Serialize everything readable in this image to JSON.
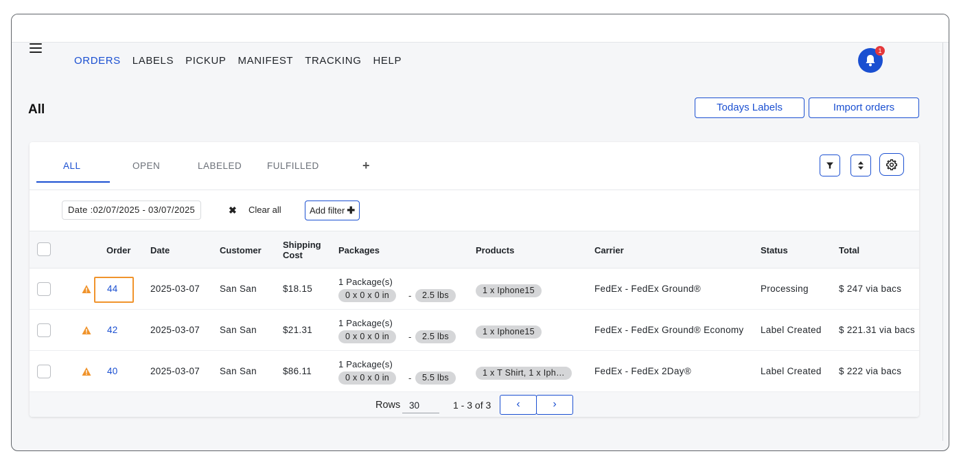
{
  "nav": {
    "items": [
      "ORDERS",
      "LABELS",
      "PICKUP",
      "MANIFEST",
      "TRACKING",
      "HELP"
    ],
    "notification_count": "1"
  },
  "page": {
    "title": "All",
    "todays_labels_label": "Todays Labels",
    "import_orders_label": "Import orders"
  },
  "tabs": {
    "all": "ALL",
    "open": "OPEN",
    "labeled": "LABELED",
    "fulfilled": "FULFILLED",
    "add": "+"
  },
  "filters": {
    "date_chip": "Date :02/07/2025 - 03/07/2025",
    "clear_icon": "✖",
    "clear_all": "Clear all",
    "add_filter": "Add filter",
    "add_filter_icon": "✚"
  },
  "columns": {
    "order": "Order",
    "date": "Date",
    "customer": "Customer",
    "shipping_cost_1": "Shipping",
    "shipping_cost_2": "Cost",
    "packages": "Packages",
    "products": "Products",
    "carrier": "Carrier",
    "status": "Status",
    "total": "Total"
  },
  "rows": [
    {
      "order": "44",
      "date": "2025-03-07",
      "customer": "San San",
      "shipping_cost": "$18.15",
      "packages": "1 Package(s)",
      "dimensions": "0 x 0 x 0 in",
      "dash": "-",
      "weight": "2.5 lbs",
      "products": "1 x Iphone15",
      "carrier": "FedEx - FedEx Ground®",
      "status": "Processing",
      "total": "$ 247 via bacs"
    },
    {
      "order": "42",
      "date": "2025-03-07",
      "customer": "San San",
      "shipping_cost": "$21.31",
      "packages": "1 Package(s)",
      "dimensions": "0 x 0 x 0 in",
      "dash": "-",
      "weight": "2.5 lbs",
      "products": "1 x Iphone15",
      "carrier": "FedEx - FedEx Ground® Economy",
      "status": "Label Created",
      "total": "$ 221.31 via bacs"
    },
    {
      "order": "40",
      "date": "2025-03-07",
      "customer": "San San",
      "shipping_cost": "$86.11",
      "packages": "1 Package(s)",
      "dimensions": "0 x 0 x 0 in",
      "dash": "-",
      "weight": "5.5 lbs",
      "products": "1 x T Shirt, 1 x Iph…",
      "carrier": "FedEx - FedEx 2Day®",
      "status": "Label Created",
      "total": "$ 222 via bacs"
    }
  ],
  "pagination": {
    "rows_label": "Rows",
    "rows_value": "30",
    "range": "1 - 3 of 3",
    "prev": "‹",
    "next": "›"
  },
  "colors": {
    "accent": "#1a4fd1",
    "warning": "#f0932b",
    "badge": "#e5383b"
  }
}
